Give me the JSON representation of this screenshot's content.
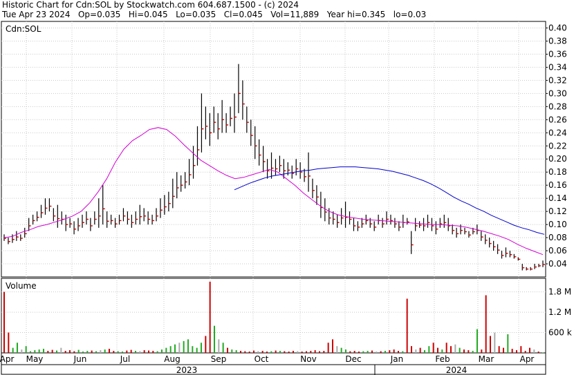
{
  "header": {
    "line1": "Historic Chart for Cdn:SOL by Stockwatch.com 604.687.1500 - (c) 2024",
    "line2": "Tue Apr 23 2024   Op=0.035   Hi=0.045   Lo=0.035   Cl=0.045   Vol=11,889   Year hi=0.345   lo=0.03"
  },
  "chart_data": {
    "type": "line",
    "symbol_label": "Cdn:SOL",
    "volume_label": "Volume",
    "price_axis": {
      "ticks": [
        0.04,
        0.06,
        0.08,
        0.1,
        0.12,
        0.14,
        0.16,
        0.18,
        0.2,
        0.22,
        0.24,
        0.26,
        0.28,
        0.3,
        0.32,
        0.34,
        0.36,
        0.38,
        0.4
      ],
      "tick_labels": [
        "0.04",
        "0.06",
        "0.08",
        "0.10",
        "0.12",
        "0.14",
        "0.16",
        "0.18",
        "0.20",
        "0.22",
        "0.24",
        "0.26",
        "0.28",
        "0.30",
        "0.32",
        "0.34",
        "0.36",
        "0.38",
        "0.40"
      ],
      "ylim": [
        0.02,
        0.41
      ]
    },
    "volume_axis": {
      "ticks": [
        600000,
        1200000,
        1800000
      ],
      "tick_labels": [
        "600 k",
        "1.2 M",
        "1.8 M"
      ],
      "ylim": [
        0,
        2200000
      ]
    },
    "x_axis": {
      "months": [
        "Apr",
        "May",
        "Jun",
        "Jul",
        "Aug",
        "Sep",
        "Oct",
        "Nov",
        "Dec",
        "Jan",
        "Feb",
        "Mar",
        "Apr"
      ],
      "years": [
        "2023",
        "2024"
      ]
    },
    "grid": true,
    "price_bars": [
      [
        0.085,
        0.075
      ],
      [
        0.08,
        0.07
      ],
      [
        0.085,
        0.072
      ],
      [
        0.09,
        0.075
      ],
      [
        0.085,
        0.075
      ],
      [
        0.095,
        0.08
      ],
      [
        0.11,
        0.09
      ],
      [
        0.115,
        0.1
      ],
      [
        0.12,
        0.105
      ],
      [
        0.13,
        0.11
      ],
      [
        0.14,
        0.115
      ],
      [
        0.14,
        0.12
      ],
      [
        0.125,
        0.105
      ],
      [
        0.13,
        0.095
      ],
      [
        0.12,
        0.1
      ],
      [
        0.115,
        0.09
      ],
      [
        0.11,
        0.095
      ],
      [
        0.105,
        0.085
      ],
      [
        0.11,
        0.09
      ],
      [
        0.115,
        0.095
      ],
      [
        0.12,
        0.1
      ],
      [
        0.11,
        0.09
      ],
      [
        0.12,
        0.1
      ],
      [
        0.14,
        0.095
      ],
      [
        0.16,
        0.1
      ],
      [
        0.12,
        0.095
      ],
      [
        0.115,
        0.1
      ],
      [
        0.11,
        0.095
      ],
      [
        0.115,
        0.1
      ],
      [
        0.125,
        0.105
      ],
      [
        0.12,
        0.1
      ],
      [
        0.115,
        0.095
      ],
      [
        0.12,
        0.1
      ],
      [
        0.13,
        0.1
      ],
      [
        0.125,
        0.105
      ],
      [
        0.12,
        0.1
      ],
      [
        0.115,
        0.1
      ],
      [
        0.125,
        0.105
      ],
      [
        0.14,
        0.11
      ],
      [
        0.145,
        0.115
      ],
      [
        0.15,
        0.12
      ],
      [
        0.17,
        0.125
      ],
      [
        0.18,
        0.14
      ],
      [
        0.175,
        0.15
      ],
      [
        0.18,
        0.155
      ],
      [
        0.2,
        0.16
      ],
      [
        0.22,
        0.17
      ],
      [
        0.25,
        0.19
      ],
      [
        0.3,
        0.21
      ],
      [
        0.28,
        0.23
      ],
      [
        0.27,
        0.22
      ],
      [
        0.28,
        0.24
      ],
      [
        0.27,
        0.23
      ],
      [
        0.29,
        0.24
      ],
      [
        0.27,
        0.24
      ],
      [
        0.28,
        0.25
      ],
      [
        0.3,
        0.24
      ],
      [
        0.345,
        0.27
      ],
      [
        0.32,
        0.26
      ],
      [
        0.28,
        0.24
      ],
      [
        0.26,
        0.22
      ],
      [
        0.25,
        0.2
      ],
      [
        0.23,
        0.19
      ],
      [
        0.22,
        0.18
      ],
      [
        0.2,
        0.17
      ],
      [
        0.21,
        0.17
      ],
      [
        0.2,
        0.175
      ],
      [
        0.205,
        0.18
      ],
      [
        0.2,
        0.17
      ],
      [
        0.195,
        0.175
      ],
      [
        0.19,
        0.17
      ],
      [
        0.2,
        0.175
      ],
      [
        0.195,
        0.17
      ],
      [
        0.185,
        0.165
      ],
      [
        0.21,
        0.15
      ],
      [
        0.17,
        0.14
      ],
      [
        0.16,
        0.13
      ],
      [
        0.15,
        0.11
      ],
      [
        0.14,
        0.105
      ],
      [
        0.125,
        0.1
      ],
      [
        0.12,
        0.1
      ],
      [
        0.115,
        0.095
      ],
      [
        0.125,
        0.1
      ],
      [
        0.135,
        0.095
      ],
      [
        0.12,
        0.1
      ],
      [
        0.11,
        0.09
      ],
      [
        0.105,
        0.09
      ],
      [
        0.11,
        0.095
      ],
      [
        0.115,
        0.1
      ],
      [
        0.11,
        0.095
      ],
      [
        0.105,
        0.09
      ],
      [
        0.115,
        0.1
      ],
      [
        0.11,
        0.095
      ],
      [
        0.12,
        0.1
      ],
      [
        0.115,
        0.1
      ],
      [
        0.11,
        0.095
      ],
      [
        0.105,
        0.09
      ],
      [
        0.115,
        0.095
      ],
      [
        0.11,
        0.1
      ],
      [
        0.09,
        0.055
      ],
      [
        0.11,
        0.09
      ],
      [
        0.105,
        0.095
      ],
      [
        0.11,
        0.09
      ],
      [
        0.115,
        0.095
      ],
      [
        0.11,
        0.09
      ],
      [
        0.105,
        0.085
      ],
      [
        0.11,
        0.095
      ],
      [
        0.115,
        0.095
      ],
      [
        0.11,
        0.09
      ],
      [
        0.1,
        0.085
      ],
      [
        0.095,
        0.08
      ],
      [
        0.1,
        0.085
      ],
      [
        0.095,
        0.085
      ],
      [
        0.09,
        0.08
      ],
      [
        0.095,
        0.085
      ],
      [
        0.1,
        0.085
      ],
      [
        0.09,
        0.075
      ],
      [
        0.085,
        0.07
      ],
      [
        0.08,
        0.065
      ],
      [
        0.075,
        0.06
      ],
      [
        0.07,
        0.055
      ],
      [
        0.06,
        0.048
      ],
      [
        0.065,
        0.05
      ],
      [
        0.06,
        0.05
      ],
      [
        0.055,
        0.048
      ],
      [
        0.05,
        0.045
      ],
      [
        0.04,
        0.03
      ],
      [
        0.035,
        0.03
      ],
      [
        0.035,
        0.03
      ],
      [
        0.04,
        0.032
      ],
      [
        0.04,
        0.035
      ],
      [
        0.045,
        0.035
      ]
    ],
    "ma_short": [
      0.08,
      0.082,
      0.088,
      0.092,
      0.097,
      0.1,
      0.104,
      0.108,
      0.113,
      0.12,
      0.133,
      0.15,
      0.17,
      0.195,
      0.215,
      0.228,
      0.236,
      0.245,
      0.248,
      0.245,
      0.235,
      0.222,
      0.21,
      0.198,
      0.19,
      0.182,
      0.175,
      0.17,
      0.172,
      0.176,
      0.18,
      0.184,
      0.18,
      0.17,
      0.16,
      0.148,
      0.138,
      0.128,
      0.12,
      0.115,
      0.112,
      0.11,
      0.108,
      0.107,
      0.106,
      0.105,
      0.104,
      0.103,
      0.102,
      0.101,
      0.1,
      0.1,
      0.099,
      0.098,
      0.096,
      0.093,
      0.09,
      0.086,
      0.082,
      0.077,
      0.07,
      0.064,
      0.059,
      0.054
    ],
    "ma_long_start_index": 56,
    "ma_long": [
      0.153,
      0.158,
      0.163,
      0.167,
      0.171,
      0.174,
      0.176,
      0.178,
      0.18,
      0.182,
      0.183,
      0.185,
      0.186,
      0.187,
      0.188,
      0.188,
      0.188,
      0.187,
      0.186,
      0.185,
      0.183,
      0.181,
      0.178,
      0.175,
      0.171,
      0.167,
      0.162,
      0.156,
      0.149,
      0.142,
      0.136,
      0.131,
      0.125,
      0.12,
      0.114,
      0.109,
      0.104,
      0.099,
      0.095,
      0.092,
      0.088,
      0.085
    ],
    "volume": [
      1800000,
      600000,
      150000,
      300000,
      100000,
      200000,
      50000,
      80000,
      100000,
      120000,
      60000,
      90000,
      70000,
      150000,
      60000,
      80000,
      50000,
      90000,
      40000,
      60000,
      70000,
      50000,
      80000,
      100000,
      120000,
      60000,
      50000,
      40000,
      70000,
      90000,
      60000,
      50000,
      80000,
      70000,
      60000,
      50000,
      100000,
      150000,
      200000,
      250000,
      300000,
      350000,
      400000,
      200000,
      150000,
      300000,
      500000,
      2100000,
      800000,
      400000,
      300000,
      150000,
      100000,
      80000,
      60000,
      50000,
      40000,
      70000,
      50000,
      60000,
      40000,
      50000,
      70000,
      60000,
      50000,
      40000,
      60000,
      50000,
      40000,
      50000,
      60000,
      80000,
      50000,
      60000,
      300000,
      400000,
      200000,
      150000,
      100000,
      50000,
      60000,
      40000,
      50000,
      60000,
      70000,
      40000,
      50000,
      60000,
      80000,
      100000,
      60000,
      50000,
      1600000,
      200000,
      100000,
      150000,
      80000,
      200000,
      300000,
      150000,
      100000,
      300000,
      200000,
      250000,
      150000,
      100000,
      80000,
      60000,
      700000,
      100000,
      1700000,
      500000,
      600000,
      200000,
      150000,
      550000,
      120000,
      80000,
      200000,
      60000,
      150000,
      100000,
      40000,
      12000
    ]
  }
}
